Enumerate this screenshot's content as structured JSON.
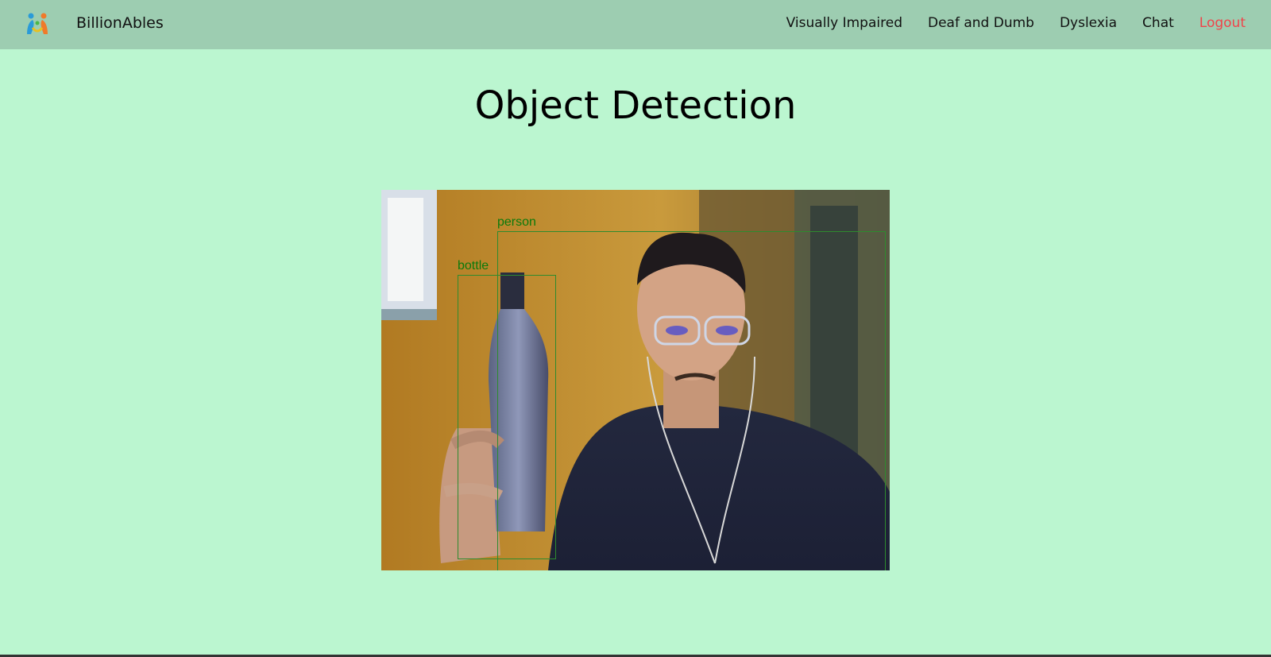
{
  "header": {
    "brand": "BillionAbles",
    "nav": [
      {
        "label": "Visually Impaired"
      },
      {
        "label": "Deaf and Dumb"
      },
      {
        "label": "Dyslexia"
      },
      {
        "label": "Chat"
      },
      {
        "label": "Logout"
      }
    ]
  },
  "main": {
    "title": "Object Detection"
  },
  "detections": [
    {
      "label": "person"
    },
    {
      "label": "bottle"
    }
  ],
  "colors": {
    "background": "#bbf6d0",
    "navbar": "#9dcdb1",
    "logout": "#f0444a",
    "detection_box": "#2e8b2e"
  }
}
